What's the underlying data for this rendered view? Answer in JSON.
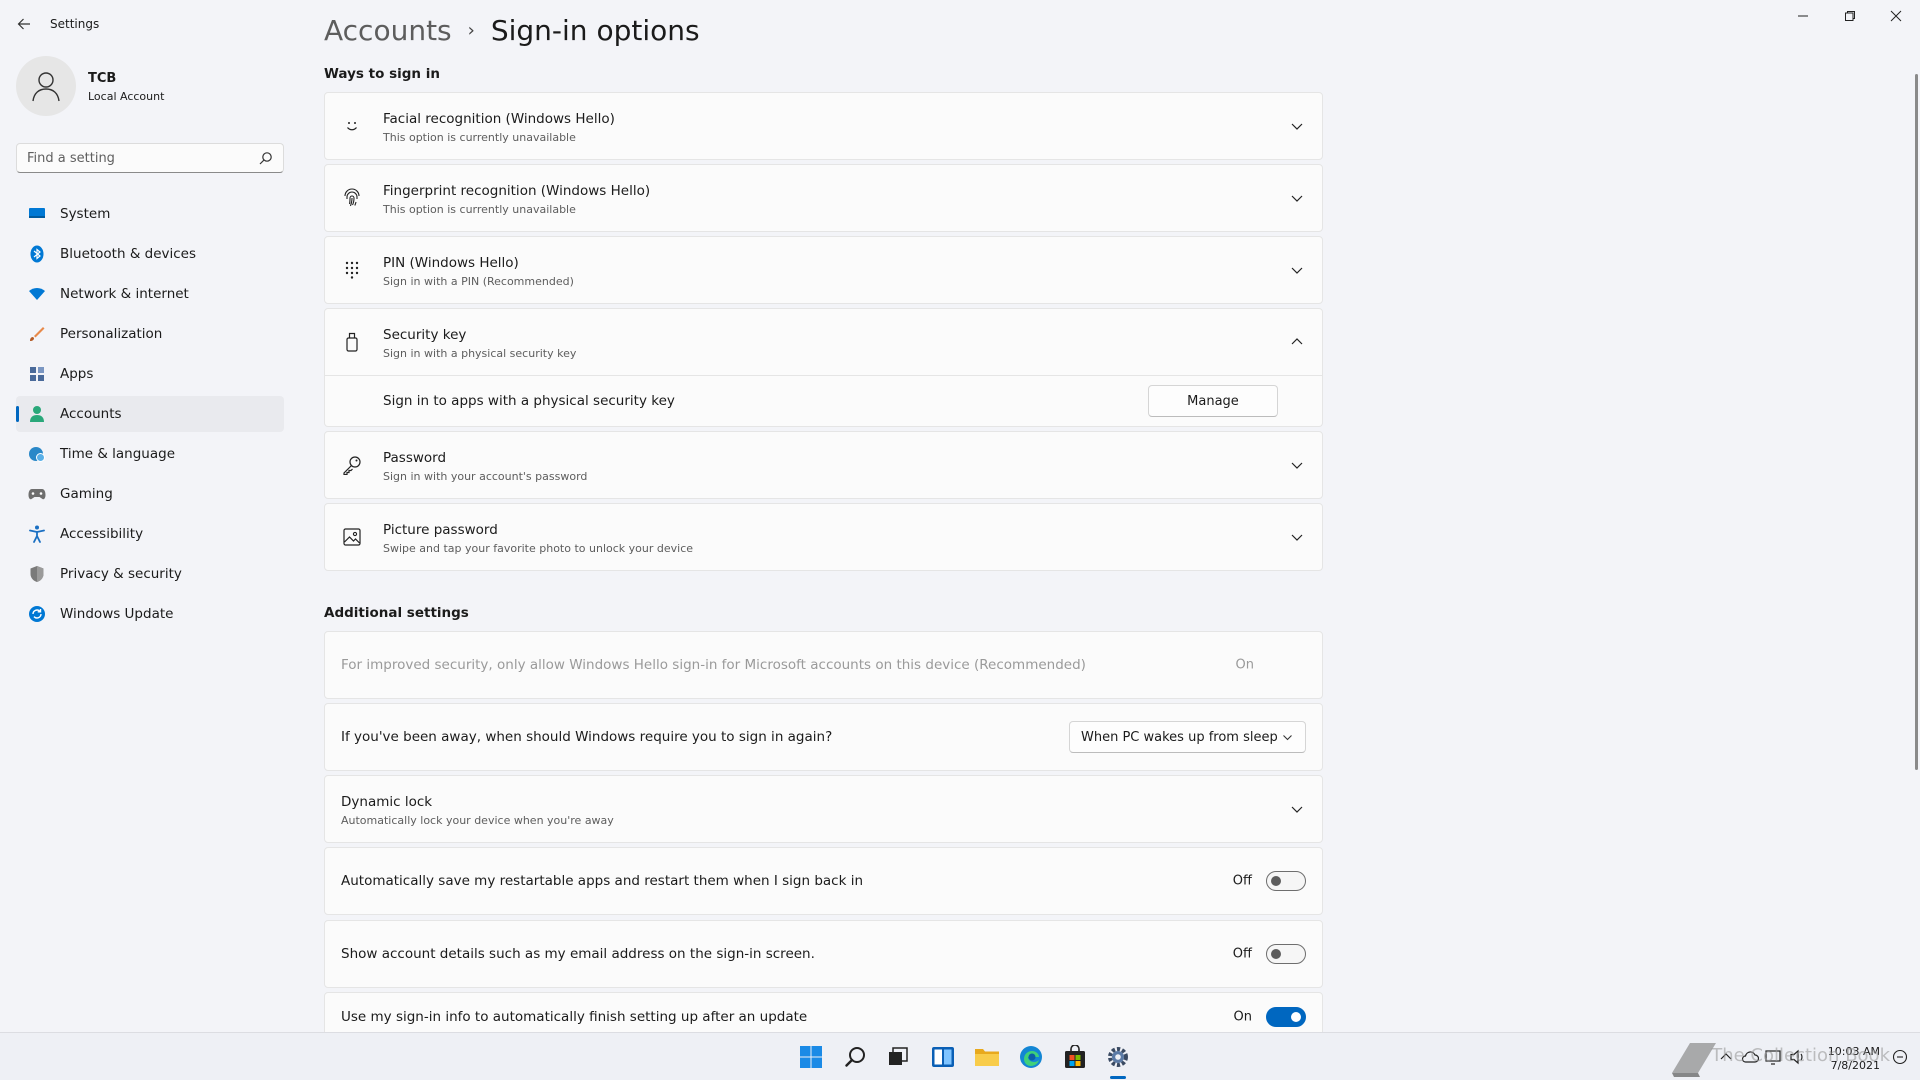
{
  "app": {
    "title": "Settings"
  },
  "user": {
    "name": "TCB",
    "account_type": "Local Account"
  },
  "search": {
    "placeholder": "Find a setting"
  },
  "nav": [
    {
      "label": "System",
      "icon": "monitor-icon",
      "color": "#0078d4"
    },
    {
      "label": "Bluetooth & devices",
      "icon": "bluetooth-icon",
      "color": "#0078d4"
    },
    {
      "label": "Network & internet",
      "icon": "wifi-icon",
      "color": "#0078d4"
    },
    {
      "label": "Personalization",
      "icon": "brush-icon",
      "color": "#e8894a"
    },
    {
      "label": "Apps",
      "icon": "apps-icon",
      "color": "#4a6a9a"
    },
    {
      "label": "Accounts",
      "icon": "person-icon",
      "color": "#2aa87a"
    },
    {
      "label": "Time & language",
      "icon": "globe-clock-icon",
      "color": "#2a88c8"
    },
    {
      "label": "Gaming",
      "icon": "gamepad-icon",
      "color": "#6e6e6e"
    },
    {
      "label": "Accessibility",
      "icon": "accessibility-icon",
      "color": "#1a6fc2"
    },
    {
      "label": "Privacy & security",
      "icon": "shield-icon",
      "color": "#6e6e6e"
    },
    {
      "label": "Windows Update",
      "icon": "update-icon",
      "color": "#0078d4"
    }
  ],
  "breadcrumb": {
    "parent": "Accounts",
    "separator": "›",
    "current": "Sign-in options"
  },
  "ways": {
    "title": "Ways to sign in",
    "items": [
      {
        "title": "Facial recognition (Windows Hello)",
        "subtitle": "This option is currently unavailable",
        "icon": "face-icon",
        "expanded": false
      },
      {
        "title": "Fingerprint recognition (Windows Hello)",
        "subtitle": "This option is currently unavailable",
        "icon": "fingerprint-icon",
        "expanded": false
      },
      {
        "title": "PIN (Windows Hello)",
        "subtitle": "Sign in with a PIN (Recommended)",
        "icon": "pin-keypad-icon",
        "expanded": false
      },
      {
        "title": "Security key",
        "subtitle": "Sign in with a physical security key",
        "icon": "usb-key-icon",
        "expanded": true
      },
      {
        "title": "Password",
        "subtitle": "Sign in with your account's password",
        "icon": "key-icon",
        "expanded": false
      },
      {
        "title": "Picture password",
        "subtitle": "Swipe and tap your favorite photo to unlock your device",
        "icon": "picture-icon",
        "expanded": false
      }
    ],
    "security_key_detail": {
      "label": "Sign in to apps with a physical security key",
      "button": "Manage"
    }
  },
  "additional": {
    "title": "Additional settings",
    "hello_only": {
      "label": "For improved security, only allow Windows Hello sign-in for Microsoft accounts on this device (Recommended)",
      "state": "On"
    },
    "require_signin": {
      "label": "If you've been away, when should Windows require you to sign in again?",
      "value": "When PC wakes up from sleep"
    },
    "dynamic_lock": {
      "title": "Dynamic lock",
      "subtitle": "Automatically lock your device when you're away"
    },
    "restart_apps": {
      "label": "Automatically save my restartable apps and restart them when I sign back in",
      "state": "Off"
    },
    "account_details": {
      "label": "Show account details such as my email address on the sign-in screen.",
      "state": "Off"
    },
    "finish_setup": {
      "label": "Use my sign-in info to automatically finish setting up after an update",
      "state": "On"
    }
  },
  "taskbar": {
    "time": "10:03 AM",
    "date": "7/8/2021",
    "watermark": "The Collection Book"
  }
}
